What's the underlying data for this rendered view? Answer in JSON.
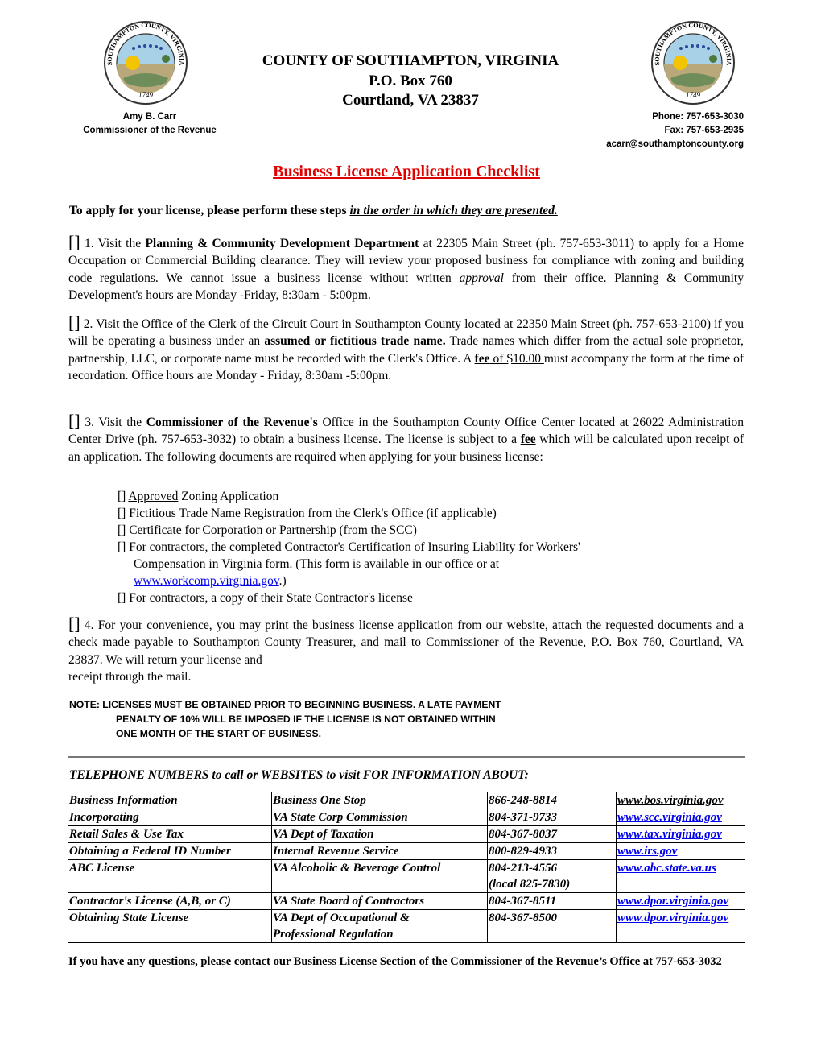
{
  "header": {
    "org_title": "COUNTY OF SOUTHAMPTON, VIRGINIA",
    "po_box": "P.O. Box 760",
    "city": "Courtland, VA  23837",
    "official_name": "Amy B. Carr",
    "official_title": "Commissioner of the Revenue",
    "phone": "Phone: 757-653-3030",
    "fax": "Fax:  757-653-2935",
    "email": "acarr@southamptoncounty.org",
    "seal": {
      "top_text": "SOUTHAMPTON COUNTY, VIRGINIA",
      "year": "1749"
    }
  },
  "document": {
    "title": "Business License Application Checklist",
    "intro_plain": "To apply for your license, please perform these steps ",
    "intro_emph": "in the order in which they are presented.",
    "checkbox_glyph": "[]",
    "steps": [
      {
        "a": " 1. Visit the ",
        "b_bold": "Planning & Community Development Department",
        "c": " at 22305 Main Street (ph. 757-653-3011) to apply for a Home Occupation or Commercial Building clearance. They will review your proposed business for compliance with zoning and building code regulations. We cannot issue a business license without written ",
        "d_emph": "approval ",
        "e": "from their office. Planning & Community Development's hours are Monday -Friday, 8:30am - 5:00pm."
      },
      {
        "a": " 2. Visit the Office of the Clerk of the Circuit Court in Southampton County located at 22350 Main Street (ph. 757-653-2100) if you will be operating a business under an ",
        "b_bold": "assumed or fictitious trade name.",
        "c": " Trade names which differ from the actual sole proprietor, partnership, LLC, or corporate name must be recorded with the Clerk's Office. A ",
        "d_fee_bold": "fee",
        "d_fee_rest": " of $10.00 ",
        "e": "must accompany the form at the time of recordation. Office hours are Monday - Friday, 8:30am -5:00pm."
      },
      {
        "a": " 3. Visit the ",
        "b_bold": "Commissioner of the Revenue's",
        "c": " Office in the Southampton County Office Center located at 26022 Administration Center Drive (ph. 757-653-3032) to obtain a business license. The license is subject to a ",
        "d_fee_bold": "fee",
        "e": " which will be calculated upon receipt of an application. The following documents are required when applying for your business license:",
        "documents": [
          {
            "prefix": "[] ",
            "underlined": "Approved",
            "rest": " Zoning Application"
          },
          {
            "prefix": "[] ",
            "text": "Fictitious Trade Name Registration from the Clerk's Office (if applicable)"
          },
          {
            "prefix": "[] ",
            "text": "Certificate for Corporation or Partnership (from the SCC)"
          },
          {
            "prefix": "[] ",
            "text": "For contractors, the completed Contractor's Certification of Insuring Liability for Workers'",
            "cont1": "Compensation in Virginia form. (This form is available in our office or at",
            "link": "www.workcomp.virginia.gov",
            "cont2": ".)"
          },
          {
            "prefix": "[] ",
            "text": "For contractors, a copy of their State Contractor's license"
          }
        ]
      },
      {
        "a": " 4. For your convenience, you may print the business license application from our website, attach the requested documents and a check made payable to Southampton County Treasurer, and mail to Commissioner of the Revenue, P.O. Box 760, Courtland, VA 23837.  We will return your license and",
        "b": "receipt through the mail."
      }
    ],
    "note": {
      "line1": "NOTE:  LICENSES MUST BE OBTAINED PRIOR TO BEGINNING BUSINESS. A LATE PAYMENT",
      "line2": "PENALTY OF 10% WILL BE IMPOSED IF THE LICENSE IS NOT OBTAINED WITHIN",
      "line3": "ONE MONTH OF THE START OF BUSINESS."
    },
    "contacts_heading": "TELEPHONE NUMBERS to call or WEBSITES to visit FOR INFORMATION ABOUT:",
    "contacts": [
      {
        "topic": "Business Information",
        "agency": "Business One Stop",
        "phone": "866-248-8814",
        "phone2": "",
        "website": "www.bos.virginia.gov",
        "agency2": ""
      },
      {
        "topic": "Incorporating",
        "agency": "VA State Corp Commission",
        "phone": "804-371-9733",
        "phone2": "",
        "website": "www.scc.virginia.gov",
        "agency2": ""
      },
      {
        "topic": "Retail Sales & Use Tax",
        "agency": "VA Dept of Taxation",
        "phone": "804-367-8037",
        "phone2": "",
        "website": "www.tax.virginia.gov",
        "agency2": ""
      },
      {
        "topic": "Obtaining a Federal ID Number",
        "agency": "Internal Revenue Service",
        "phone": "800-829-4933",
        "phone2": "",
        "website": "www.irs.gov",
        "agency2": ""
      },
      {
        "topic": "ABC License",
        "agency": "VA Alcoholic & Beverage Control",
        "phone": "804-213-4556",
        "phone2": "(local 825-7830)",
        "website": "www.abc.state.va.us",
        "agency2": ""
      },
      {
        "topic": "Contractor's License (A,B, or C)",
        "agency": "VA State Board of Contractors",
        "phone": "804-367-8511",
        "phone2": "",
        "website": "www.dpor.virginia.gov",
        "agency2": ""
      },
      {
        "topic": "Obtaining State License",
        "agency": "VA Dept of Occupational &",
        "agency2": "Professional Regulation",
        "phone": "804-367-8500",
        "phone2": "",
        "website": "www.dpor.virginia.gov"
      }
    ],
    "footer": "If you have any questions, please contact our Business License Section of the Commissioner of the Revenue’s Office at 757-653-3032"
  },
  "colors": {
    "title_red": "#e00000",
    "link_blue": "#0000ee",
    "seal_sky": "#a8d0e6",
    "seal_sun": "#f5c400",
    "seal_field": "#b9a87a"
  }
}
